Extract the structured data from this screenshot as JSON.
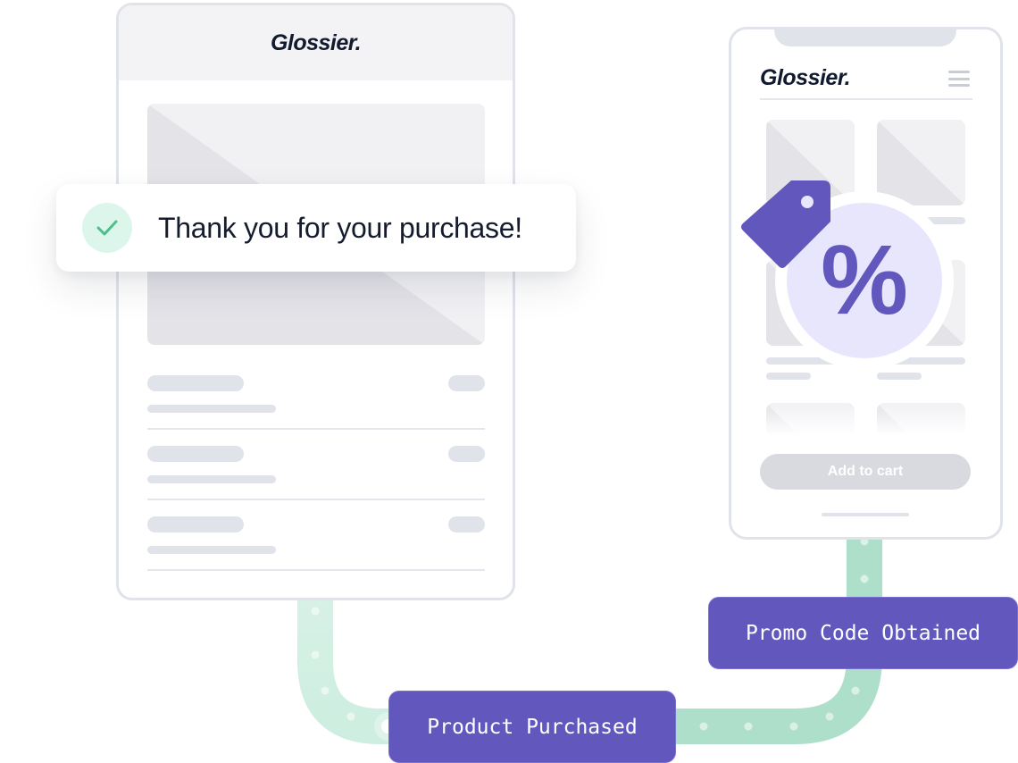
{
  "email": {
    "brand": "Glossier.",
    "line_items": 3
  },
  "toast": {
    "icon": "check-icon",
    "message": "Thank you for your purchase!"
  },
  "phone": {
    "brand": "Glossier.",
    "menu_icon": "hamburger-icon",
    "add_to_cart_label": "Add to cart"
  },
  "discount": {
    "symbol": "%",
    "icon": "price-tag-icon"
  },
  "events": [
    {
      "label": "Product Purchased"
    },
    {
      "label": "Promo Code Obtained"
    }
  ],
  "colors": {
    "accent": "#6157bd",
    "connector": "#aedfcb",
    "success": "#4cbf8a",
    "success_bg": "#ddf6ec",
    "placeholder": "#e1e3ea",
    "discount_bg": "#e8e6fd",
    "text_dark": "#141c2e"
  }
}
